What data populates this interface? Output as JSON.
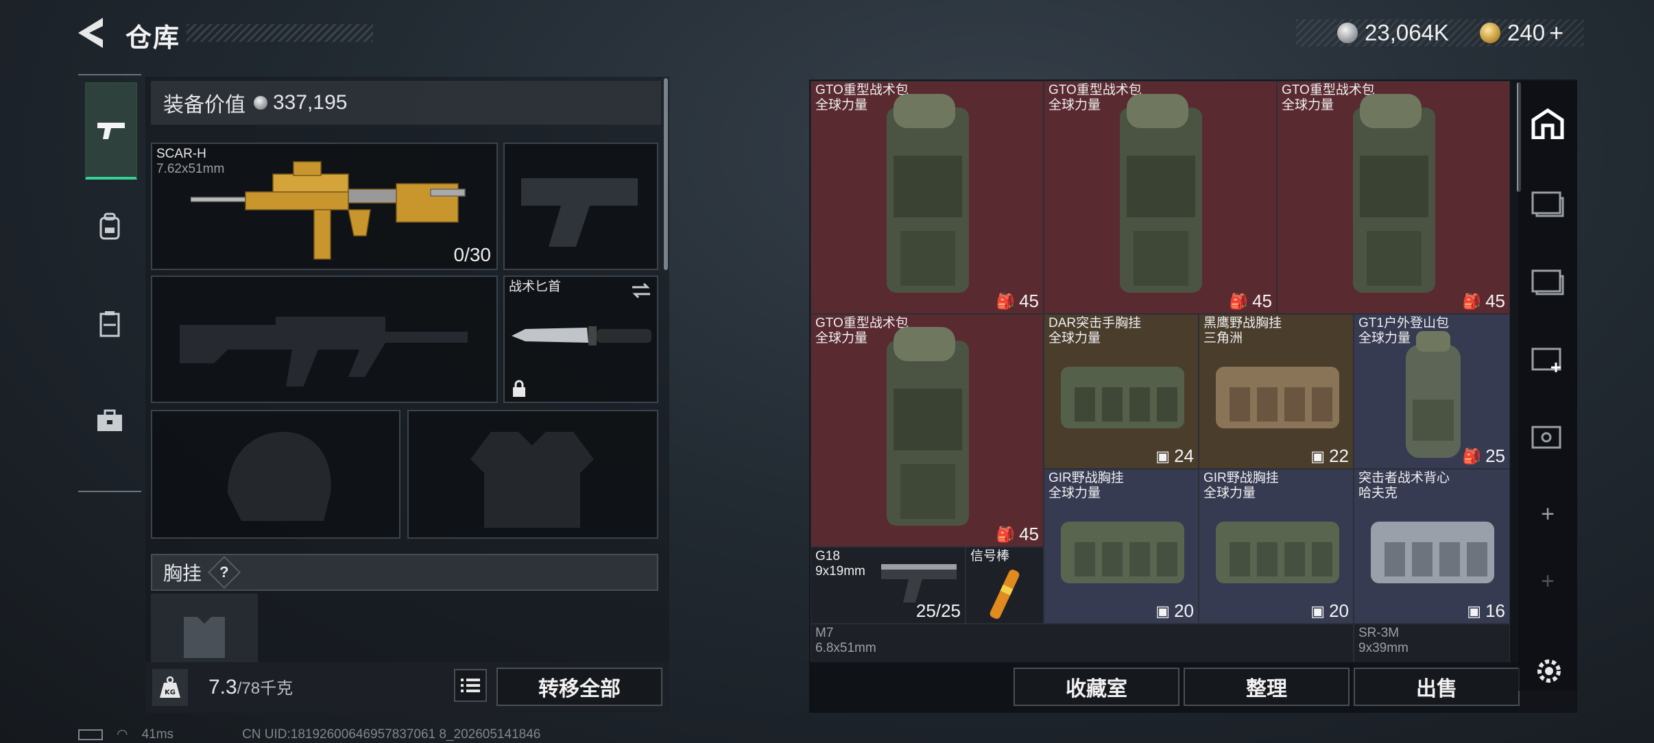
{
  "header": {
    "title": "仓库"
  },
  "currency": {
    "silver": "23,064K",
    "gold": "240",
    "gold_plus": "+"
  },
  "side_tabs": [
    "weapon-icon",
    "backpack-icon",
    "vest-icon",
    "case-icon"
  ],
  "loadout": {
    "value_label": "装备价值",
    "value": "337,195",
    "primary": {
      "name": "SCAR-H",
      "caliber": "7.62x51mm",
      "ammo": "0/30"
    },
    "melee": {
      "name": "战术匕首"
    },
    "chest_header": "胸挂",
    "chest_help": "?",
    "weight": "7.3",
    "weight_max": "/78千克",
    "weight_icon_label": "KG",
    "transfer_all": "转移全部"
  },
  "storage": {
    "items": [
      {
        "name": "GTO重型战术包",
        "sub": "全球力量",
        "count": "45"
      },
      {
        "name": "GTO重型战术包",
        "sub": "全球力量",
        "count": "45"
      },
      {
        "name": "GTO重型战术包",
        "sub": "全球力量",
        "count": "45"
      },
      {
        "name": "GTO重型战术包",
        "sub": "全球力量",
        "count": "45"
      },
      {
        "name": "DAR突击手胸挂",
        "sub": "全球力量",
        "count": "24"
      },
      {
        "name": "黑鹰野战胸挂",
        "sub": "三角洲",
        "count": "22"
      },
      {
        "name": "GT1户外登山包",
        "sub": "全球力量",
        "count": "25"
      },
      {
        "name": "GIR野战胸挂",
        "sub": "全球力量",
        "count": "20"
      },
      {
        "name": "GIR野战胸挂",
        "sub": "全球力量",
        "count": "20"
      },
      {
        "name": "突击者战术背心",
        "sub": "哈夫克",
        "count": "16"
      },
      {
        "name": "G18",
        "sub": "9x19mm",
        "count": "25/25"
      },
      {
        "name": "信号棒",
        "sub": "",
        "count": ""
      },
      {
        "name": "M7",
        "sub": "6.8x51mm",
        "count": ""
      },
      {
        "name": "SR-3M",
        "sub": "9x39mm",
        "count": ""
      }
    ],
    "buttons": {
      "collection": "收藏室",
      "organize": "整理",
      "sell": "出售"
    }
  },
  "right_tabs": [
    "home-storage-icon",
    "folder-iv-1-icon",
    "folder-iv-2-icon",
    "folder-iv-add-icon",
    "folder-v-icon",
    "add-icon",
    "add-disabled-icon"
  ],
  "status": {
    "ping": "41ms",
    "uid": "CN UID:18192600646957837061 8_202605141846"
  }
}
